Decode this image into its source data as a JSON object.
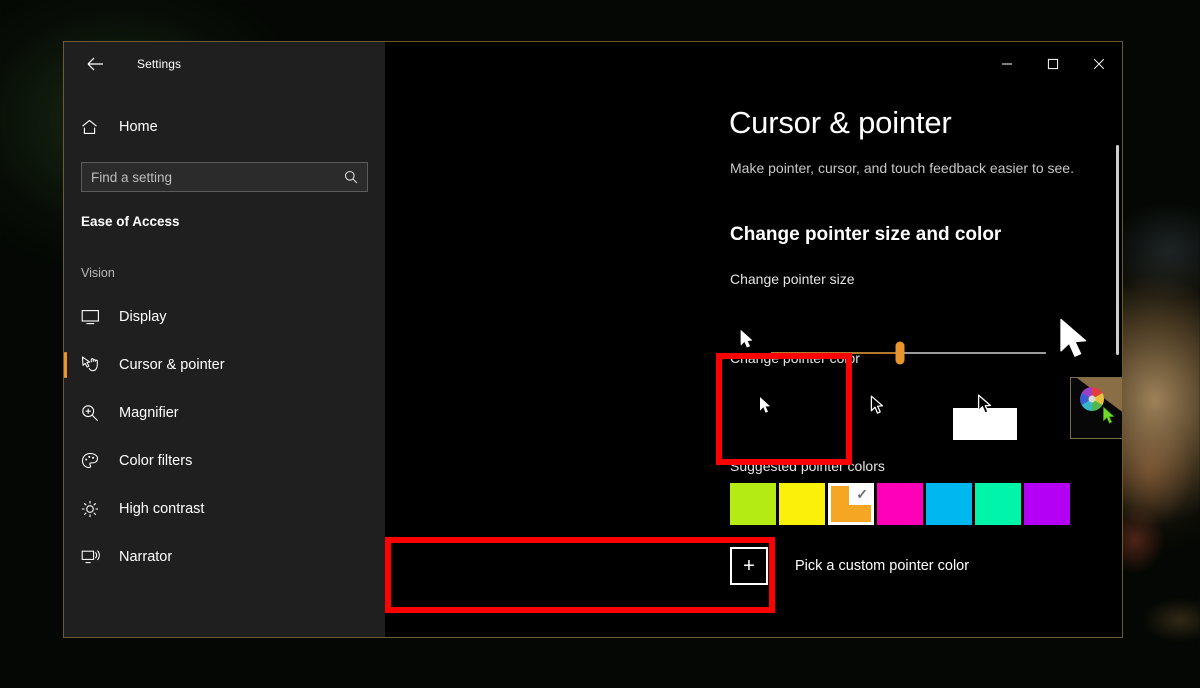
{
  "window": {
    "app_title": "Settings",
    "back_icon": "back-arrow-icon",
    "controls": {
      "minimize": "—",
      "maximize": "☐",
      "close": "✕"
    }
  },
  "sidebar": {
    "home_label": "Home",
    "home_icon": "home-icon",
    "search": {
      "placeholder": "Find a setting",
      "value": "",
      "icon": "search-icon"
    },
    "category": "Ease of Access",
    "group_label": "Vision",
    "items": [
      {
        "label": "Display",
        "icon": "monitor-icon",
        "selected": false
      },
      {
        "label": "Cursor & pointer",
        "icon": "cursor-pointer-icon",
        "selected": true
      },
      {
        "label": "Magnifier",
        "icon": "magnifier-icon",
        "selected": false
      },
      {
        "label": "Color filters",
        "icon": "palette-icon",
        "selected": false
      },
      {
        "label": "High contrast",
        "icon": "sun-icon",
        "selected": false
      },
      {
        "label": "Narrator",
        "icon": "narrator-icon",
        "selected": false
      }
    ],
    "accent_color": "#e9942c"
  },
  "main": {
    "page_title": "Cursor & pointer",
    "page_subtitle": "Make pointer, cursor, and touch feedback easier to see.",
    "section_heading": "Change pointer size and color",
    "pointer_size": {
      "label": "Change pointer size",
      "value_percent": 47,
      "min_icon": "small-cursor-icon",
      "max_icon": "large-cursor-icon",
      "track_color": "#9a9a9a",
      "fill_color": "#b5792c",
      "thumb_color": "#e9942c"
    },
    "pointer_color": {
      "label": "Change pointer color",
      "options": [
        {
          "name": "white-pointer",
          "icon": "filled-cursor-icon",
          "selected": false
        },
        {
          "name": "black-pointer",
          "icon": "outline-cursor-icon",
          "selected": false
        },
        {
          "name": "inverted-pointer",
          "icon": "inverted-cursor-icon",
          "selected": false
        },
        {
          "name": "custom-pointer",
          "icon": "color-wheel-icon",
          "selected": true,
          "check": "✔"
        }
      ]
    },
    "suggested_colors": {
      "label": "Suggested pointer colors",
      "check": "✓",
      "swatches": [
        {
          "name": "lime-green",
          "hex": "#b4eb15",
          "selected": false
        },
        {
          "name": "yellow",
          "hex": "#fbf009",
          "selected": false
        },
        {
          "name": "amber",
          "hex": "#f5a623",
          "selected": true
        },
        {
          "name": "magenta",
          "hex": "#ff00b8",
          "selected": false
        },
        {
          "name": "azure-blue",
          "hex": "#00b7f0",
          "selected": false
        },
        {
          "name": "spring-green",
          "hex": "#00f5ab",
          "selected": false
        },
        {
          "name": "purple",
          "hex": "#b400f5",
          "selected": false
        }
      ]
    },
    "custom_color_button": {
      "label": "Pick a custom pointer color",
      "plus_glyph": "+"
    }
  },
  "annotations": {
    "color": "#fe0000",
    "boxes": [
      {
        "name": "custom-pointer-tile-highlight"
      },
      {
        "name": "pick-custom-color-highlight"
      }
    ]
  }
}
